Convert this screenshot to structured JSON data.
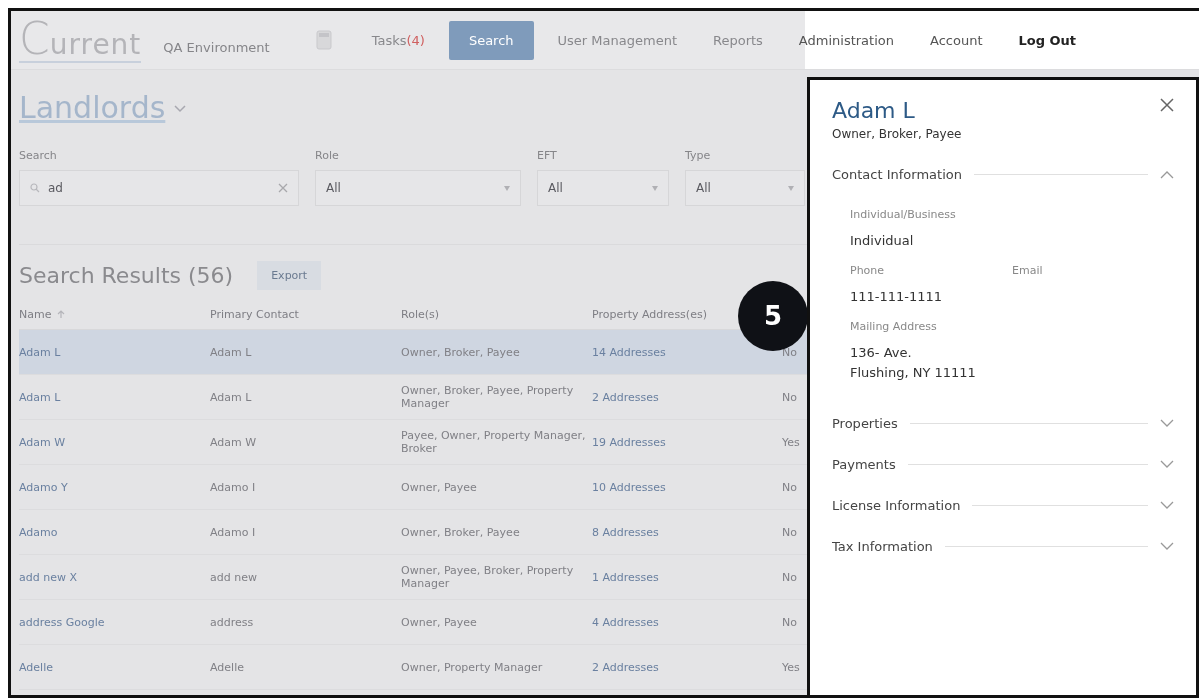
{
  "nav": {
    "logo": {
      "initial": "C",
      "rest": "urrent"
    },
    "environment": "QA Environment",
    "items": [
      {
        "label": "Tasks",
        "count": "(4)",
        "kind": "link",
        "selected": false
      },
      {
        "label": "Search",
        "kind": "button",
        "selected": true
      },
      {
        "label": "User Management",
        "kind": "link",
        "selected": false
      },
      {
        "label": "Reports",
        "kind": "link",
        "selected": false
      },
      {
        "label": "Administration",
        "kind": "link",
        "selected": false
      },
      {
        "label": "Account",
        "kind": "link",
        "selected": false
      },
      {
        "label": "Log Out",
        "kind": "strong",
        "selected": false
      }
    ]
  },
  "page": {
    "title": "Landlords",
    "filters": [
      {
        "label": "Search",
        "kind": "search",
        "value": "ad"
      },
      {
        "label": "Role",
        "kind": "select",
        "value": "All"
      },
      {
        "label": "EFT",
        "kind": "select",
        "value": "All"
      },
      {
        "label": "Type",
        "kind": "select",
        "value": "All"
      }
    ],
    "results_title": "Search Results (56)",
    "export_button": "Export",
    "table": {
      "columns": [
        "Name",
        "Primary Contact",
        "Role(s)",
        "Property Address(es)"
      ],
      "rows": [
        {
          "selected": true,
          "cells": [
            "Adam L",
            "Adam L",
            "Owner, Broker, Payee",
            "14 Addresses",
            "No"
          ]
        },
        {
          "selected": false,
          "cells": [
            "Adam L",
            "Adam L",
            "Owner, Broker, Payee, Property Manager",
            "2 Addresses",
            "No"
          ]
        },
        {
          "selected": false,
          "cells": [
            "Adam W",
            "Adam W",
            "Payee, Owner, Property Manager, Broker",
            "19 Addresses",
            "Yes"
          ]
        },
        {
          "selected": false,
          "cells": [
            "Adamo Y",
            "Adamo I",
            "Owner, Payee",
            "10 Addresses",
            "No"
          ]
        },
        {
          "selected": false,
          "cells": [
            "Adamo",
            "Adamo I",
            "Owner, Broker, Payee",
            "8 Addresses",
            "No"
          ]
        },
        {
          "selected": false,
          "cells": [
            "add new X",
            "add new",
            "Owner, Payee, Broker, Property Manager",
            "1 Addresses",
            "No"
          ]
        },
        {
          "selected": false,
          "cells": [
            "address Google",
            "address",
            "Owner, Payee",
            "4 Addresses",
            "No"
          ]
        },
        {
          "selected": false,
          "cells": [
            "Adelle",
            "Adelle",
            "Owner, Property Manager",
            "2 Addresses",
            "Yes"
          ]
        }
      ]
    }
  },
  "step_badge": "5",
  "drawer": {
    "name": "Adam L",
    "roles": "Owner, Broker, Payee",
    "sections": [
      {
        "title": "Contact Information",
        "expanded": true,
        "fields": [
          {
            "label": "Individual/Business",
            "value": "Individual",
            "kind": "full"
          },
          {
            "label": "Phone",
            "value": "111-111-1111",
            "kind": "half"
          },
          {
            "label": "Email",
            "kind": "half"
          },
          {
            "label": "Mailing Address",
            "value": "136- Ave.\nFlushing, NY  11111",
            "kind": "full"
          }
        ]
      },
      {
        "title": "Properties",
        "expanded": false
      },
      {
        "title": "Payments",
        "expanded": false
      },
      {
        "title": "License Information",
        "expanded": false
      },
      {
        "title": "Tax Information",
        "expanded": false
      }
    ]
  }
}
